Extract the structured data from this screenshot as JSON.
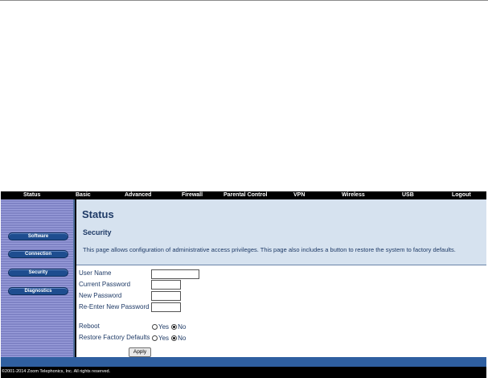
{
  "nav": {
    "items": [
      {
        "label": "Status",
        "active": true
      },
      {
        "label": "Basic",
        "active": false
      },
      {
        "label": "Advanced",
        "active": false
      },
      {
        "label": "Firewall",
        "active": false
      },
      {
        "label": "Parental Control",
        "active": false
      },
      {
        "label": "VPN",
        "active": false
      },
      {
        "label": "Wireless",
        "active": false
      },
      {
        "label": "USB",
        "active": false
      },
      {
        "label": "Logout",
        "active": false
      }
    ],
    "active_color": "#f7d21a"
  },
  "sidebar": {
    "items": [
      {
        "label": "Software",
        "active": false
      },
      {
        "label": "Connection",
        "active": false
      },
      {
        "label": "Security",
        "active": true
      },
      {
        "label": "Diagnostics",
        "active": false
      }
    ]
  },
  "page": {
    "title": "Status",
    "section_title": "Security",
    "description": "This page allows configuration of administrative access privileges. This page also includes a button to restore the system to factory defaults."
  },
  "form": {
    "username_label": "User Name",
    "username_value": "",
    "current_password_label": "Current Password",
    "new_password_label": "New Password",
    "reenter_password_label": "Re-Enter New Password",
    "reboot_label": "Reboot",
    "reboot_selected": "No",
    "factory_label": "Restore Factory Defaults",
    "factory_selected": "No",
    "yes_label": "Yes",
    "no_label": "No",
    "apply_label": "Apply"
  },
  "footer": {
    "text": "©2001-2014 Zoom Telephonics, Inc. All rights reserved."
  },
  "colors": {
    "accent_yellow": "#f7d21a",
    "title_blue": "#1e3a66",
    "button_blue": "#1e4d8f"
  }
}
